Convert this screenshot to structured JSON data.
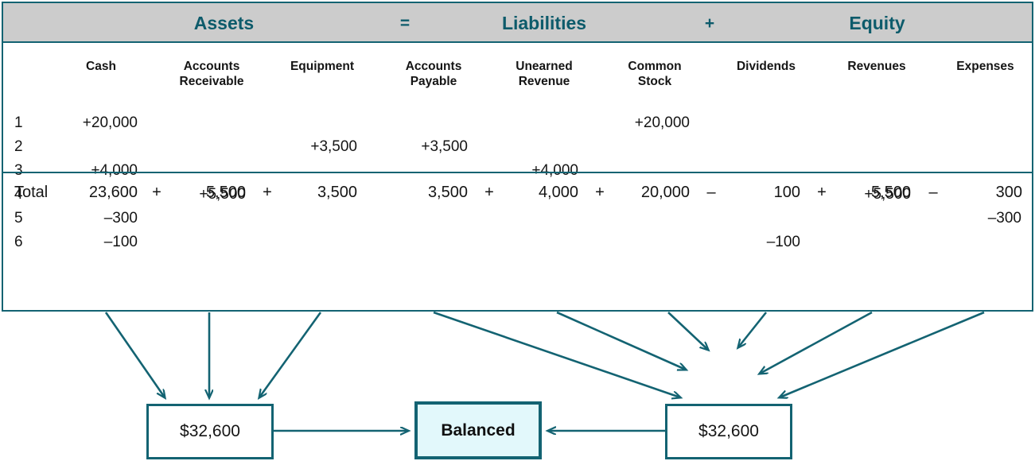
{
  "equation_band": {
    "assets_label": "Assets",
    "equals_op": "=",
    "liabilities_label": "Liabilities",
    "plus_op": "+",
    "equity_label": "Equity"
  },
  "columns": [
    {
      "key": "cash",
      "label": "Cash",
      "group": "assets"
    },
    {
      "key": "accounts_receivable",
      "label": "Accounts\nReceivable",
      "group": "assets"
    },
    {
      "key": "equipment",
      "label": "Equipment",
      "group": "assets"
    },
    {
      "key": "accounts_payable",
      "label": "Accounts\nPayable",
      "group": "liabilities"
    },
    {
      "key": "unearned_revenue",
      "label": "Unearned\nRevenue",
      "group": "liabilities"
    },
    {
      "key": "common_stock",
      "label": "Common\nStock",
      "group": "equity"
    },
    {
      "key": "dividends",
      "label": "Dividends",
      "group": "equity"
    },
    {
      "key": "revenues",
      "label": "Revenues",
      "group": "equity"
    },
    {
      "key": "expenses",
      "label": "Expenses",
      "group": "equity"
    }
  ],
  "transactions": [
    {
      "num": "1",
      "cash": "+20,000",
      "accounts_receivable": "",
      "equipment": "",
      "accounts_payable": "",
      "unearned_revenue": "",
      "common_stock": "+20,000",
      "dividends": "",
      "revenues": "",
      "expenses": ""
    },
    {
      "num": "2",
      "cash": "",
      "accounts_receivable": "",
      "equipment": "+3,500",
      "accounts_payable": "+3,500",
      "unearned_revenue": "",
      "common_stock": "",
      "dividends": "",
      "revenues": "",
      "expenses": ""
    },
    {
      "num": "3",
      "cash": "+4,000",
      "accounts_receivable": "",
      "equipment": "",
      "accounts_payable": "",
      "unearned_revenue": "+4,000",
      "common_stock": "",
      "dividends": "",
      "revenues": "",
      "expenses": ""
    },
    {
      "num": "4",
      "cash": "",
      "accounts_receivable": "+5,500",
      "equipment": "",
      "accounts_payable": "",
      "unearned_revenue": "",
      "common_stock": "",
      "dividends": "",
      "revenues": "+5,500",
      "expenses": ""
    },
    {
      "num": "5",
      "cash": "–300",
      "accounts_receivable": "",
      "equipment": "",
      "accounts_payable": "",
      "unearned_revenue": "",
      "common_stock": "",
      "dividends": "",
      "revenues": "",
      "expenses": "–300"
    },
    {
      "num": "6",
      "cash": "–100",
      "accounts_receivable": "",
      "equipment": "",
      "accounts_payable": "",
      "unearned_revenue": "",
      "common_stock": "",
      "dividends": "–100",
      "revenues": "",
      "expenses": ""
    }
  ],
  "total_row": {
    "label": "Total",
    "values": {
      "cash": "23,600",
      "accounts_receivable": "5,500",
      "equipment": "3,500",
      "accounts_payable": "3,500",
      "unearned_revenue": "4,000",
      "common_stock": "20,000",
      "dividends": "100",
      "revenues": "5,500",
      "expenses": "300"
    },
    "operators": {
      "cash_ar": "+",
      "ar_equipment": "+",
      "ap_unearned": "+",
      "unearned_common": "+",
      "common_dividends": "–",
      "dividends_revenues": "+",
      "revenues_expenses": "–"
    }
  },
  "summary": {
    "assets_total": "$32,600",
    "claims_total": "$32,600",
    "balanced_label": "Balanced"
  },
  "colors": {
    "accent_teal": "#136372",
    "band_gray": "#cccccc",
    "balanced_fill": "#e2f8fb",
    "text_dark": "#151515"
  }
}
